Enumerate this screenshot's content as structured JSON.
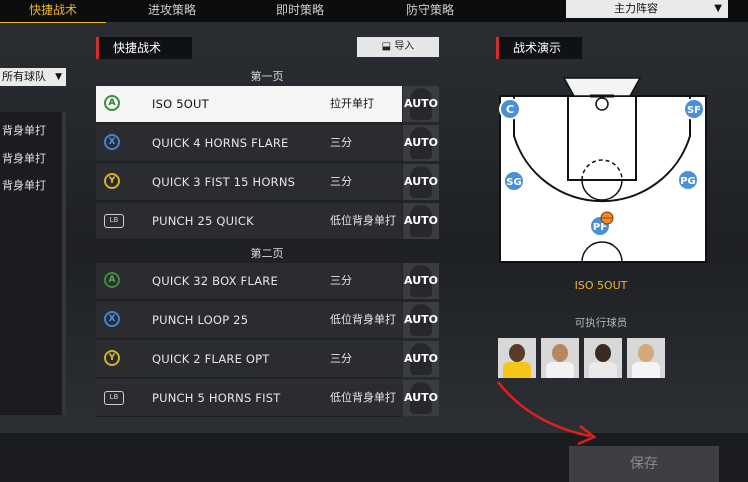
{
  "tabs": [
    {
      "label": "快捷战术",
      "active": true
    },
    {
      "label": "进攻策略",
      "active": false
    },
    {
      "label": "即时策略",
      "active": false
    },
    {
      "label": "防守策略",
      "active": false
    }
  ],
  "lineup_select": {
    "value": "主力阵容"
  },
  "left_panel": {
    "filter": "所有球队",
    "items": [
      "背身单打",
      "背身单打",
      "背身单打"
    ]
  },
  "plays_panel": {
    "title": "快捷战术",
    "import_label": "导入",
    "pages": [
      {
        "label": "第一页",
        "rows": [
          {
            "button": "A",
            "name": "ISO 5OUT",
            "type": "拉开单打",
            "auto": "AUTO",
            "selected": true
          },
          {
            "button": "X",
            "name": "QUICK 4 HORNS FLARE",
            "type": "三分",
            "auto": "AUTO",
            "selected": false
          },
          {
            "button": "Y",
            "name": "QUICK 3 FIST 15 HORNS",
            "type": "三分",
            "auto": "AUTO",
            "selected": false
          },
          {
            "button": "LB",
            "name": "PUNCH 25 QUICK",
            "type": "低位背身单打",
            "auto": "AUTO",
            "selected": false
          }
        ]
      },
      {
        "label": "第二页",
        "rows": [
          {
            "button": "A",
            "name": "QUICK 32 BOX FLARE",
            "type": "三分",
            "auto": "AUTO",
            "selected": false
          },
          {
            "button": "X",
            "name": "PUNCH LOOP 25",
            "type": "低位背身单打",
            "auto": "AUTO",
            "selected": false
          },
          {
            "button": "Y",
            "name": "QUICK 2 FLARE OPT",
            "type": "三分",
            "auto": "AUTO",
            "selected": false
          },
          {
            "button": "LB",
            "name": "PUNCH 5 HORNS FIST",
            "type": "低位背身单打",
            "auto": "AUTO",
            "selected": false
          }
        ]
      }
    ]
  },
  "demo_panel": {
    "title": "战术演示",
    "positions": [
      "C",
      "SF",
      "SG",
      "PG",
      "PF"
    ],
    "play_name": "ISO 5OUT",
    "executor_label": "可执行球员"
  },
  "save_label": "保存",
  "colors": {
    "accent": "#f0b429",
    "title_bar": "#d32f2f",
    "marker": "#4a90d9",
    "ball": "#f08a24",
    "arrow": "#e02020"
  }
}
